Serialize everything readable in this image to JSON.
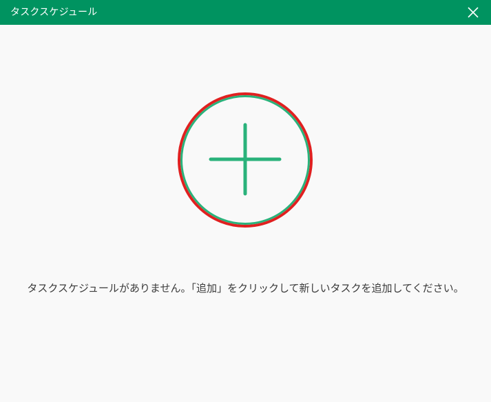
{
  "window": {
    "title": "タスクスケジュール"
  },
  "empty_state": {
    "message": "タスクスケジュールがありません。「追加」をクリックして新しいタスクを追加してください。"
  },
  "icons": {
    "close": "close-icon",
    "add": "plus-icon"
  },
  "colors": {
    "titlebar": "#009360",
    "accent": "#2ab27b",
    "highlight_ring": "#e02020",
    "background": "#f9f9f9"
  }
}
